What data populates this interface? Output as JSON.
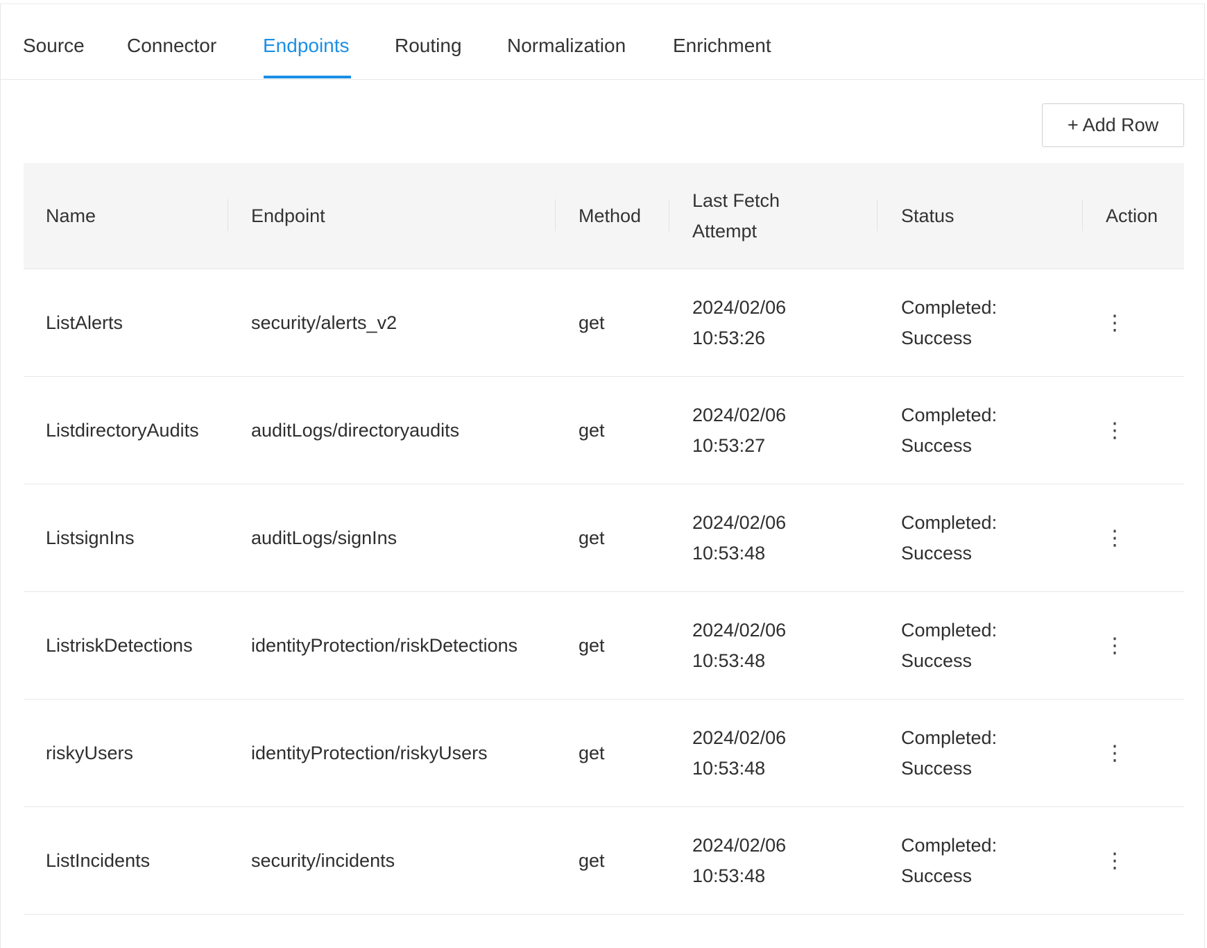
{
  "tabs": [
    {
      "label": "Source"
    },
    {
      "label": "Connector"
    },
    {
      "label": "Endpoints",
      "active": true
    },
    {
      "label": "Routing"
    },
    {
      "label": "Normalization"
    },
    {
      "label": "Enrichment"
    }
  ],
  "toolbar": {
    "add_row_label": "+ Add Row"
  },
  "table": {
    "headers": {
      "name": "Name",
      "endpoint": "Endpoint",
      "method": "Method",
      "last_fetch_line1": "Last Fetch",
      "last_fetch_line2": "Attempt",
      "status": "Status",
      "action": "Action"
    },
    "rows": [
      {
        "name": "ListAlerts",
        "endpoint": "security/alerts_v2",
        "method": "get",
        "date": "2024/02/06",
        "time": "10:53:26",
        "status_line1": "Completed:",
        "status_line2": "Success"
      },
      {
        "name": "ListdirectoryAudits",
        "endpoint": "auditLogs/directoryaudits",
        "method": "get",
        "date": "2024/02/06",
        "time": "10:53:27",
        "status_line1": "Completed:",
        "status_line2": "Success"
      },
      {
        "name": "ListsignIns",
        "endpoint": "auditLogs/signIns",
        "method": "get",
        "date": "2024/02/06",
        "time": "10:53:48",
        "status_line1": "Completed:",
        "status_line2": "Success"
      },
      {
        "name": "ListriskDetections",
        "endpoint": "identityProtection/riskDetections",
        "method": "get",
        "date": "2024/02/06",
        "time": "10:53:48",
        "status_line1": "Completed:",
        "status_line2": "Success"
      },
      {
        "name": "riskyUsers",
        "endpoint": "identityProtection/riskyUsers",
        "method": "get",
        "date": "2024/02/06",
        "time": "10:53:48",
        "status_line1": "Completed:",
        "status_line2": "Success"
      },
      {
        "name": "ListIncidents",
        "endpoint": "security/incidents",
        "method": "get",
        "date": "2024/02/06",
        "time": "10:53:48",
        "status_line1": "Completed:",
        "status_line2": "Success"
      }
    ]
  },
  "icons": {
    "row_action": "more-vertical-icon"
  },
  "colors": {
    "accent": "#1b8fe6",
    "header_bg": "#f5f5f5"
  }
}
